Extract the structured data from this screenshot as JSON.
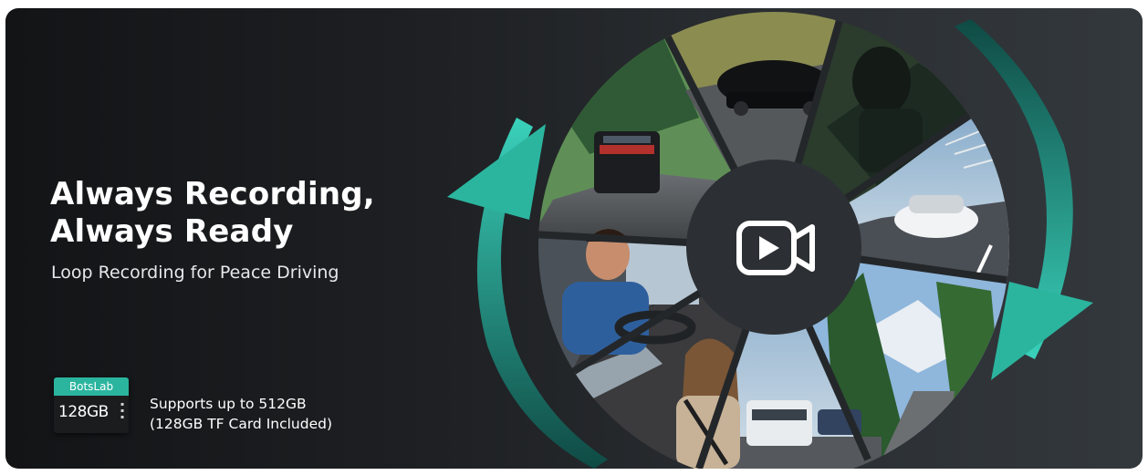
{
  "hero": {
    "title_line1": "Always Recording,",
    "title_line2": "Always Ready",
    "subtitle": "Loop Recording for Peace Driving"
  },
  "storage": {
    "card_brand": "BotsLab",
    "card_capacity": "128GB",
    "line1": "Supports up to 512GB",
    "line2": "(128GB TF Card Included)"
  },
  "colors": {
    "accent_teal": "#2bb59f",
    "background_dark": "#1d1f22",
    "center_disc": "#2c3034"
  },
  "icons": {
    "center": "video-camera-icon",
    "arrows": "loop-arrow-icon"
  },
  "photo_segments": [
    "highway-suv-rear",
    "dark-sedan-driving",
    "car-thief-break-in",
    "white-coupe-bridge",
    "mountain-road-trees",
    "suvs-on-road",
    "woman-passenger-seatbelt",
    "smiling-man-driver"
  ]
}
